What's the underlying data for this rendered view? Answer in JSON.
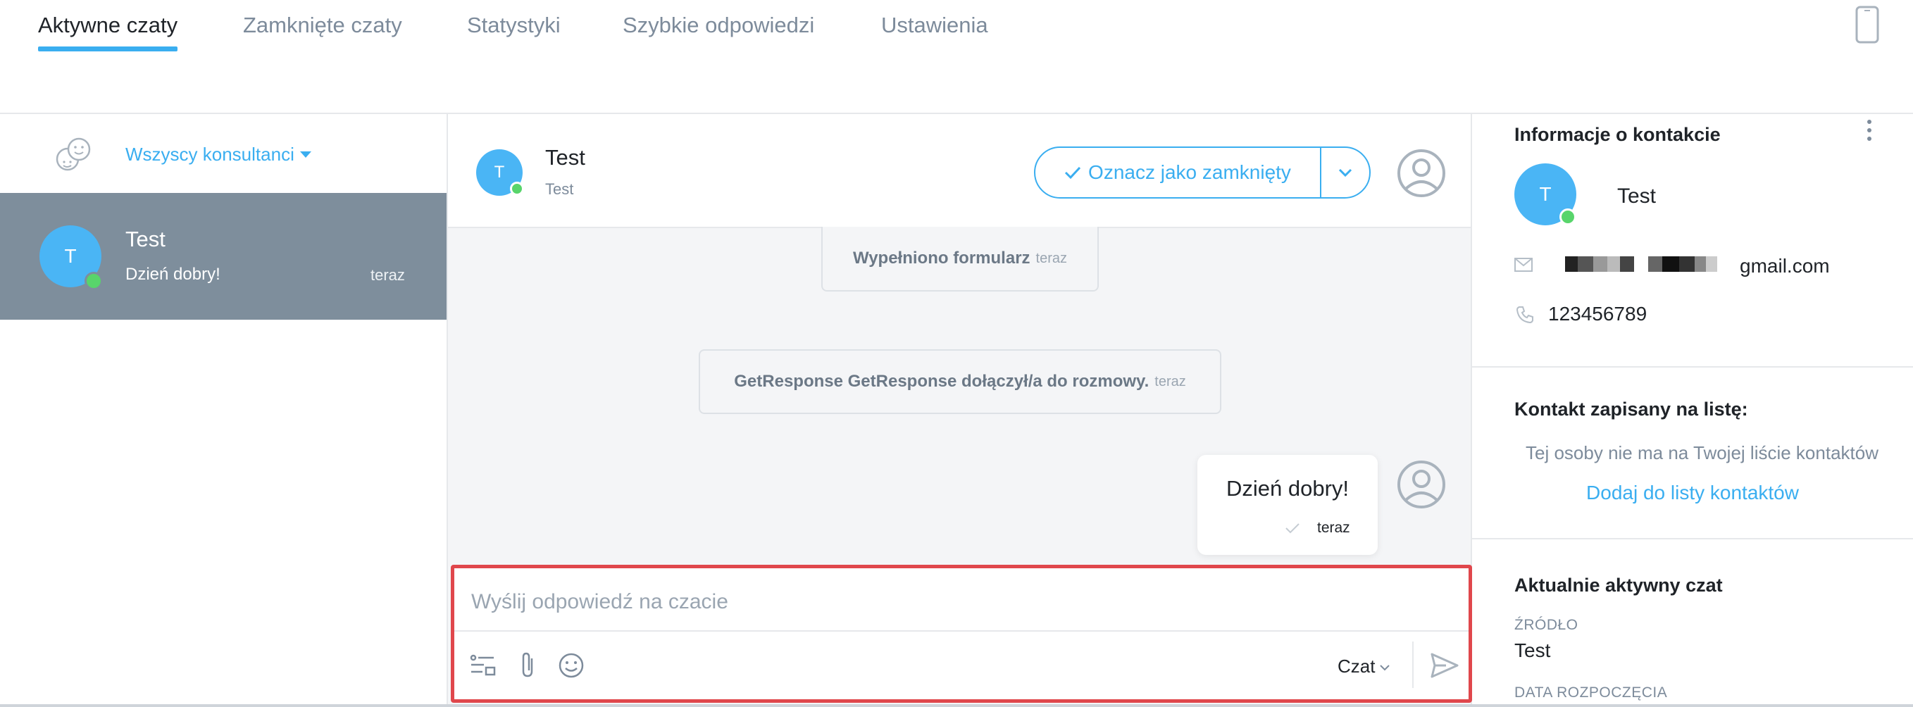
{
  "nav": {
    "tabs": [
      {
        "label": "Aktywne czaty"
      },
      {
        "label": "Zamknięte czaty"
      },
      {
        "label": "Statystyki"
      },
      {
        "label": "Szybkie odpowiedzi"
      },
      {
        "label": "Ustawienia"
      }
    ],
    "active_tab": "Aktywne czaty",
    "device_icon": "mobile-phone-icon"
  },
  "sidebar": {
    "agents_filter": {
      "label": "Wszyscy konsultanci",
      "icon": "agents-icon"
    },
    "chats": [
      {
        "initial": "T",
        "name": "Test",
        "preview": "Dzień dobry!",
        "time": "teraz",
        "online": true,
        "selected": true
      }
    ]
  },
  "chat": {
    "header": {
      "initial": "T",
      "name": "Test",
      "subtitle": "Test",
      "online": true
    },
    "close_button": {
      "label": "Oznacz jako zamknięty",
      "icon": "check-icon",
      "toggle_icon": "chevron-down-icon"
    },
    "messages": [
      {
        "type": "system",
        "text": "Wypełniono formularz",
        "time": "teraz"
      },
      {
        "type": "system",
        "text": "GetResponse GetResponse dołączył/a do rozmowy.",
        "time": "teraz"
      },
      {
        "type": "agent",
        "text": "Dzień dobry!",
        "time": "teraz",
        "status_icon": "check-icon"
      }
    ],
    "composer": {
      "placeholder": "Wyślij odpowiedź na czacie",
      "value": "",
      "tools": [
        "quick-replies-icon",
        "paperclip-icon",
        "emoji-icon"
      ],
      "channel": "Czat",
      "send_icon": "send-icon"
    }
  },
  "info": {
    "contact_title": "Informacje o kontakcie",
    "contact": {
      "initial": "T",
      "name": "Test",
      "email_visible": "gmail.com",
      "phone": "123456789",
      "online": true
    },
    "list_title": "Kontakt zapisany na listę:",
    "list_note": "Tej osoby nie ma na Twojej liście kontaktów",
    "list_link": "Dodaj do listy kontaktów",
    "active_title": "Aktualnie aktywny czat",
    "fields": [
      {
        "label": "ŹRÓDŁO",
        "value": "Test"
      },
      {
        "label": "DATA ROZPOCZĘCIA",
        "value": ""
      }
    ]
  },
  "colors": {
    "accent": "#3aaef0",
    "online": "#58d56b",
    "selected_row": "#7e8e9c",
    "composer_border": "#e0474c",
    "avatar": "#4ab5f5"
  }
}
